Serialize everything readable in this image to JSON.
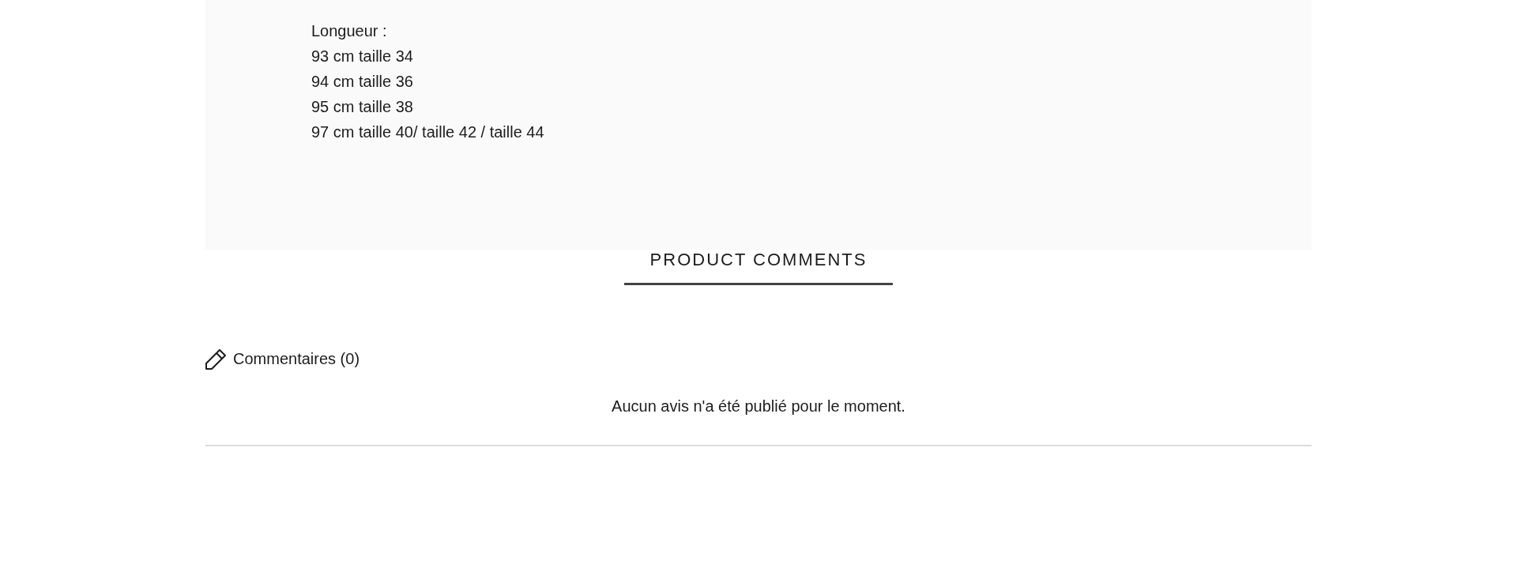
{
  "description": {
    "lines": [
      "Longueur :",
      "93 cm taille 34",
      "94 cm taille 36",
      "95 cm taille 38",
      "97 cm taille 40/ taille 42 / taille 44"
    ]
  },
  "comments_section": {
    "title": "PRODUCT COMMENTS",
    "count_label": "Commentaires (0)",
    "empty_message": "Aucun avis n'a été publié pour le moment."
  }
}
